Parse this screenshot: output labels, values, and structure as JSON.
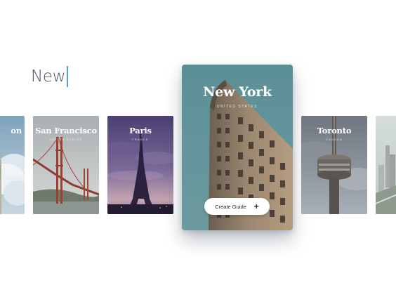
{
  "search": {
    "query": "New"
  },
  "cards": {
    "london": {
      "title": "on",
      "subtitle": ""
    },
    "san_francisco": {
      "title": "San Francisco",
      "subtitle": "UNITED STATES"
    },
    "paris": {
      "title": "Paris",
      "subtitle": "FRANCE"
    },
    "new_york": {
      "title": "New York",
      "subtitle": "UNITED STATES",
      "button_label": "Create Guide"
    },
    "toronto": {
      "title": "Toronto",
      "subtitle": "CANADA"
    },
    "next": {
      "title": ""
    }
  },
  "colors": {
    "caret": "#4aa3df",
    "search_text": "#4c5566",
    "ny_sky": "#5e8f95",
    "paris_sky": "#5e4a86",
    "toronto_sky": "#8a9099"
  },
  "icons": {
    "button_icon": "plus-icon"
  }
}
